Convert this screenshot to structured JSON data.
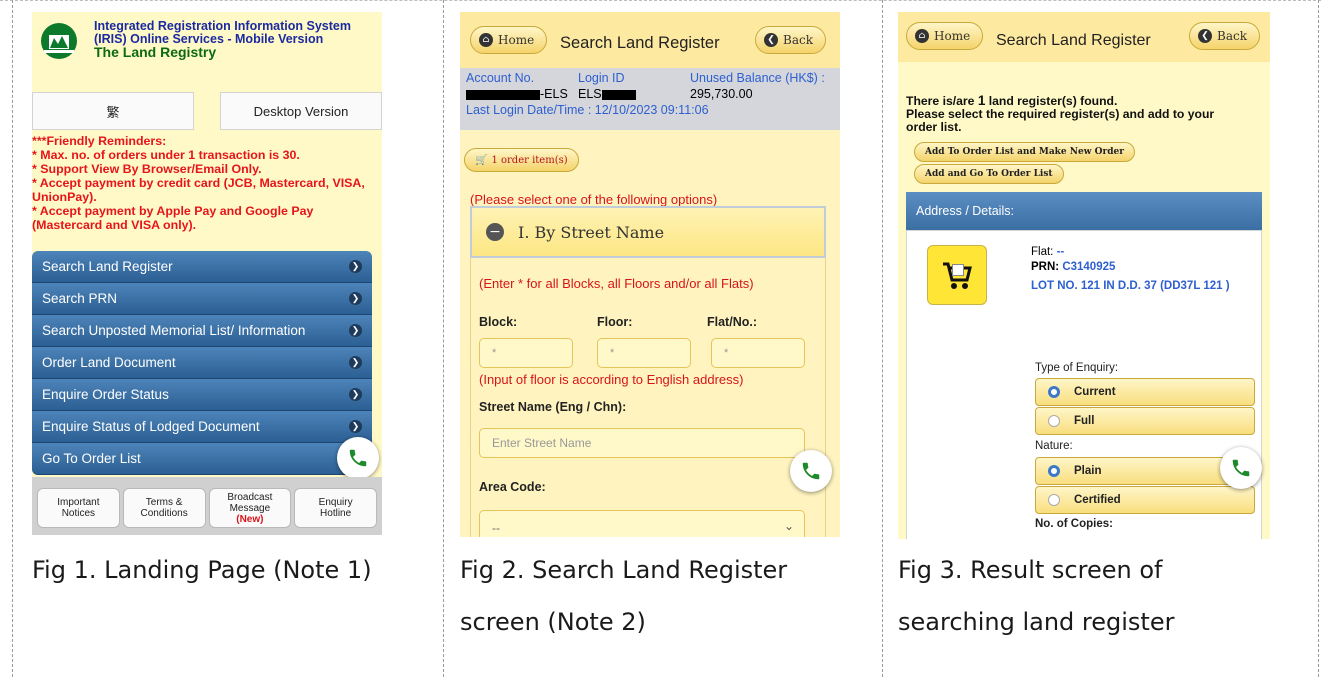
{
  "fig1": {
    "title_line1": "Integrated Registration Information System",
    "title_line2": "(IRIS) Online Services - Mobile Version",
    "title_line3": "The Land Registry",
    "lang_button": "繁",
    "desktop_button": "Desktop Version",
    "reminders": [
      "***Friendly Reminders:",
      "* Max. no. of orders under 1 transaction is 30.",
      "* Support View By Browser/Email Only.",
      "* Accept payment by credit card (JCB, Mastercard, VISA,",
      "UnionPay).",
      "* Accept payment by Apple Pay and Google Pay",
      "(Mastercard and VISA only)."
    ],
    "menu": [
      "Search Land Register",
      "Search PRN",
      "Search Unposted Memorial List/ Information",
      "Order Land Document",
      "Enquire Order Status",
      "Enquire Status of Lodged Document",
      "Go To Order List"
    ],
    "footer": [
      {
        "l1": "Important",
        "l2": "Notices",
        "l3": ""
      },
      {
        "l1": "Terms &",
        "l2": "Conditions",
        "l3": ""
      },
      {
        "l1": "Broadcast",
        "l2": "Message",
        "l3": "(New)"
      },
      {
        "l1": "Enquiry",
        "l2": "Hotline",
        "l3": ""
      }
    ]
  },
  "fig2": {
    "home": "Home",
    "back": "Back",
    "title": "Search Land Register",
    "acct_label": "Account No.",
    "login_label": "Login ID",
    "balance_label": "Unused Balance (HK$) :",
    "acct_value": "-ELS",
    "login_value": "ELS",
    "balance_value": "295,730.00",
    "last_login": "Last Login Date/Time : 12/10/2023 09:11:06",
    "order_items": "1 order item(s)",
    "select_option": "(Please select one of the following options)",
    "by_street": "I. By Street Name",
    "enter_hint": "(Enter * for all Blocks, all Floors and/or all Flats)",
    "block": "Block:",
    "floor": "Floor:",
    "flat": "Flat/No.:",
    "star": "*",
    "floor_note": "(Input of floor is according to English address)",
    "street_label": "Street Name (Eng / Chn):",
    "street_placeholder": "Enter Street Name",
    "area_label": "Area Code:",
    "area_value": "--"
  },
  "fig3": {
    "home": "Home",
    "back": "Back",
    "title": "Search Land Register",
    "found_pre": "There is/are ",
    "found_count": "1",
    "found_post": " land register(s) found.",
    "found_line2": "Please select the required register(s) and add to your",
    "found_line3": "order list.",
    "add_new": "Add To Order List and Make New Order",
    "add_go": "Add and Go To Order List",
    "addr_header": "Address / Details:",
    "flat_label": "Flat: ",
    "flat_value": "--",
    "prn_label": "PRN: ",
    "prn_value": "C3140925",
    "lot": "LOT NO. 121 IN D.D. 37 (DD37L 121 )",
    "type_label": "Type of Enquiry:",
    "current": "Current",
    "full": "Full",
    "nature_label": "Nature:",
    "plain": "Plain",
    "certified": "Certified",
    "copies_label": "No. of Copies:"
  },
  "captions": {
    "c1": "Fig 1. Landing Page (Note 1)",
    "c2a": "Fig 2. Search Land Register",
    "c2b": "screen (Note 2)",
    "c3a": "Fig 3. Result screen of",
    "c3b": "searching land register"
  },
  "colors": {
    "menu_blue": "#2c5f93",
    "reminder_red": "#e5151b",
    "call_green": "#1f8a2b",
    "page_yellow": "#fff9c7"
  }
}
